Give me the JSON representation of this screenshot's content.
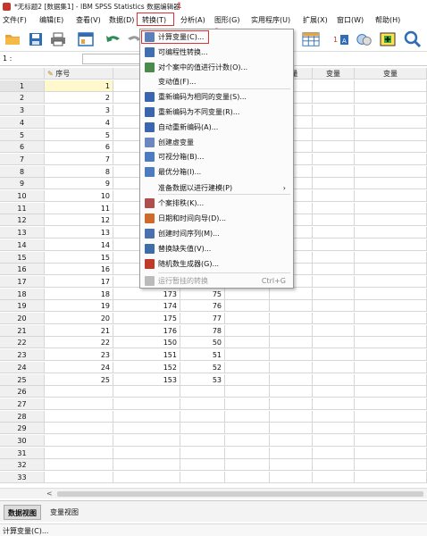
{
  "window": {
    "title": "*无标题2 [数据集1] - IBM SPSS Statistics 数据编辑器"
  },
  "menubar": {
    "items": [
      {
        "label": "文件(F)"
      },
      {
        "label": "编辑(E)"
      },
      {
        "label": "查看(V)"
      },
      {
        "label": "数据(D)"
      },
      {
        "label": "转换(T)"
      },
      {
        "label": "分析(A)"
      },
      {
        "label": "图形(G)"
      },
      {
        "label": "实用程序(U)"
      },
      {
        "label": "扩展(X)"
      },
      {
        "label": "窗口(W)"
      },
      {
        "label": "帮助(H)"
      }
    ],
    "active_index": 4
  },
  "annotations": {
    "mark_1": "1",
    "mark_2": "2"
  },
  "toolbar": {
    "icons": [
      "open-folder-icon",
      "save-icon",
      "print-icon",
      "dialog-recall-icon",
      "undo-icon",
      "redo-icon",
      "goto-case-icon",
      "value-labels-icon",
      "use-sets-icon",
      "add-icon",
      "search-icon"
    ]
  },
  "cell_ref": {
    "label": "1 :"
  },
  "grid": {
    "columns": [
      "序号",
      "",
      "",
      "变量",
      "变量",
      "变量",
      "变量"
    ],
    "rows": [
      [
        "1",
        "",
        ""
      ],
      [
        "2",
        "",
        ""
      ],
      [
        "3",
        "",
        ""
      ],
      [
        "4",
        "",
        ""
      ],
      [
        "5",
        "",
        ""
      ],
      [
        "6",
        "",
        ""
      ],
      [
        "7",
        "",
        ""
      ],
      [
        "8",
        "",
        ""
      ],
      [
        "9",
        "",
        ""
      ],
      [
        "10",
        "",
        ""
      ],
      [
        "11",
        "",
        ""
      ],
      [
        "12",
        "",
        ""
      ],
      [
        "13",
        "",
        ""
      ],
      [
        "14",
        "",
        ""
      ],
      [
        "15",
        "",
        ""
      ],
      [
        "16",
        "",
        ""
      ],
      [
        "17",
        "",
        ""
      ],
      [
        "18",
        "173",
        "75"
      ],
      [
        "19",
        "174",
        "76"
      ],
      [
        "20",
        "175",
        "77"
      ],
      [
        "21",
        "176",
        "78"
      ],
      [
        "22",
        "150",
        "50"
      ],
      [
        "23",
        "151",
        "51"
      ],
      [
        "24",
        "152",
        "52"
      ],
      [
        "25",
        "153",
        "53"
      ],
      [
        "",
        "",
        ""
      ],
      [
        "",
        "",
        ""
      ],
      [
        "",
        "",
        ""
      ],
      [
        "",
        "",
        ""
      ],
      [
        "",
        "",
        ""
      ],
      [
        "",
        "",
        ""
      ],
      [
        "",
        "",
        ""
      ],
      [
        "",
        "",
        ""
      ]
    ]
  },
  "transform_menu": {
    "items": [
      {
        "label": "计算变量(C)...",
        "icon": "calculator-icon",
        "color": "#5b7fb8"
      },
      {
        "label": "可编程性转换...",
        "icon": "programmability-icon",
        "color": "#3f6fb0"
      },
      {
        "label": "对个案中的值进行计数(O)...",
        "icon": "count-values-icon",
        "color": "#4a8a4a"
      },
      {
        "label": "变动值(F)...",
        "icon": "",
        "color": ""
      },
      {
        "label": "重新编码为相同的变量(S)...",
        "icon": "recode-same-icon",
        "color": "#3a66b0"
      },
      {
        "label": "重新编码为不同变量(R)...",
        "icon": "recode-different-icon",
        "color": "#3a66b0"
      },
      {
        "label": "自动重新编码(A)...",
        "icon": "auto-recode-icon",
        "color": "#3a66b0"
      },
      {
        "label": "创建虚变量",
        "icon": "dummy-variables-icon",
        "color": "#6b86c0"
      },
      {
        "label": "可视分箱(B)...",
        "icon": "visual-binning-icon",
        "color": "#4d7bbf"
      },
      {
        "label": "最优分箱(I)...",
        "icon": "optimal-binning-icon",
        "color": "#4d7bbf"
      },
      {
        "label": "准备数据以进行建模(P)",
        "icon": "",
        "color": ""
      },
      {
        "label": "个案排秩(K)...",
        "icon": "rank-cases-icon",
        "color": "#b04d4d"
      },
      {
        "label": "日期和时间向导(D)...",
        "icon": "date-time-wizard-icon",
        "color": "#d06a2a"
      },
      {
        "label": "创建时间序列(M)...",
        "icon": "time-series-icon",
        "color": "#4a70b0"
      },
      {
        "label": "替换缺失值(V)...",
        "icon": "replace-missing-icon",
        "color": "#3e6ea8"
      },
      {
        "label": "随机数生成器(G)...",
        "icon": "random-generator-icon",
        "color": "#c0392b"
      },
      {
        "label": "运行暂挂的转换",
        "icon": "run-pending-icon",
        "color": "#bbbbbb",
        "shortcut": "Ctrl+G",
        "disabled": true
      }
    ]
  },
  "tabs": [
    {
      "label": "数据视图"
    },
    {
      "label": "变量视图"
    }
  ],
  "status": {
    "text": "计算变量(C)..."
  }
}
